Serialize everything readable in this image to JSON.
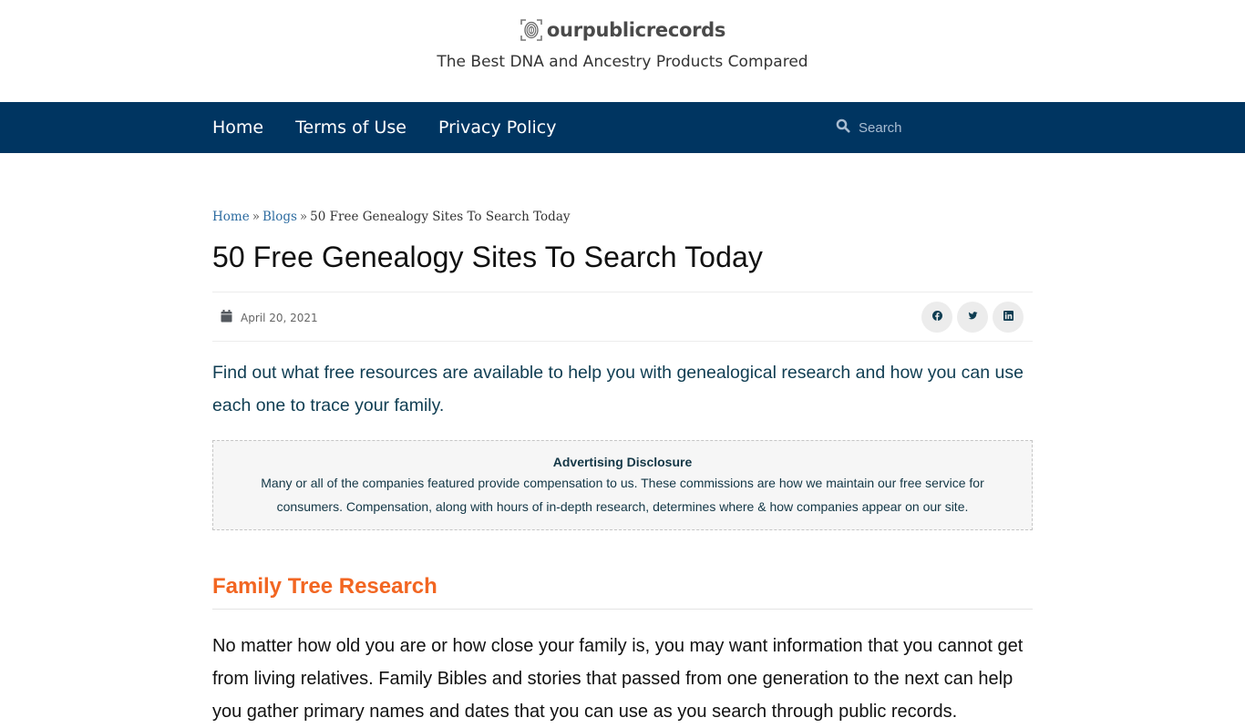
{
  "header": {
    "logo_text": "ourpublicrecords",
    "logo_icon": "fingerprint-scan-icon",
    "tagline": "The Best DNA and Ancestry Products Compared"
  },
  "nav": {
    "links": [
      {
        "label": "Home"
      },
      {
        "label": "Terms of Use"
      },
      {
        "label": "Privacy Policy"
      }
    ],
    "search": {
      "icon": "search-icon",
      "placeholder": "Search",
      "value": ""
    }
  },
  "breadcrumb": {
    "items": [
      {
        "label": "Home",
        "link": true
      },
      {
        "label": "Blogs",
        "link": true
      },
      {
        "label": "50 Free Genealogy Sites To Search Today",
        "link": false
      }
    ],
    "separator": "»"
  },
  "article": {
    "title": "50 Free Genealogy Sites To Search Today",
    "date": "April 20, 2021",
    "date_icon": "calendar-icon",
    "share": [
      {
        "network": "facebook",
        "icon": "facebook-icon"
      },
      {
        "network": "twitter",
        "icon": "twitter-icon"
      },
      {
        "network": "linkedin",
        "icon": "linkedin-icon"
      }
    ],
    "lead": "Find out what free resources are available to help you with genealogical research and how you can use each one to trace your family.",
    "disclosure": {
      "title": "Advertising Disclosure",
      "body": "Many or all of the companies featured provide compensation to us. These commissions are how we maintain our free service for consumers. Compensation, along with hours of in-depth research, determines where & how companies appear on our site."
    },
    "sections": [
      {
        "heading": "Family Tree Research",
        "body": "No matter how old you are or how close your family is, you may want information that you cannot get from living relatives. Family Bibles and stories that passed from one generation to the next can help you gather primary names and dates that you can use as you search through public records."
      }
    ]
  },
  "colors": {
    "nav_bg": "#003561",
    "link": "#2c6ba0",
    "lead_text": "#0f3d52",
    "section_heading": "#f26622",
    "disclosure_bg": "#f6f6f6"
  }
}
